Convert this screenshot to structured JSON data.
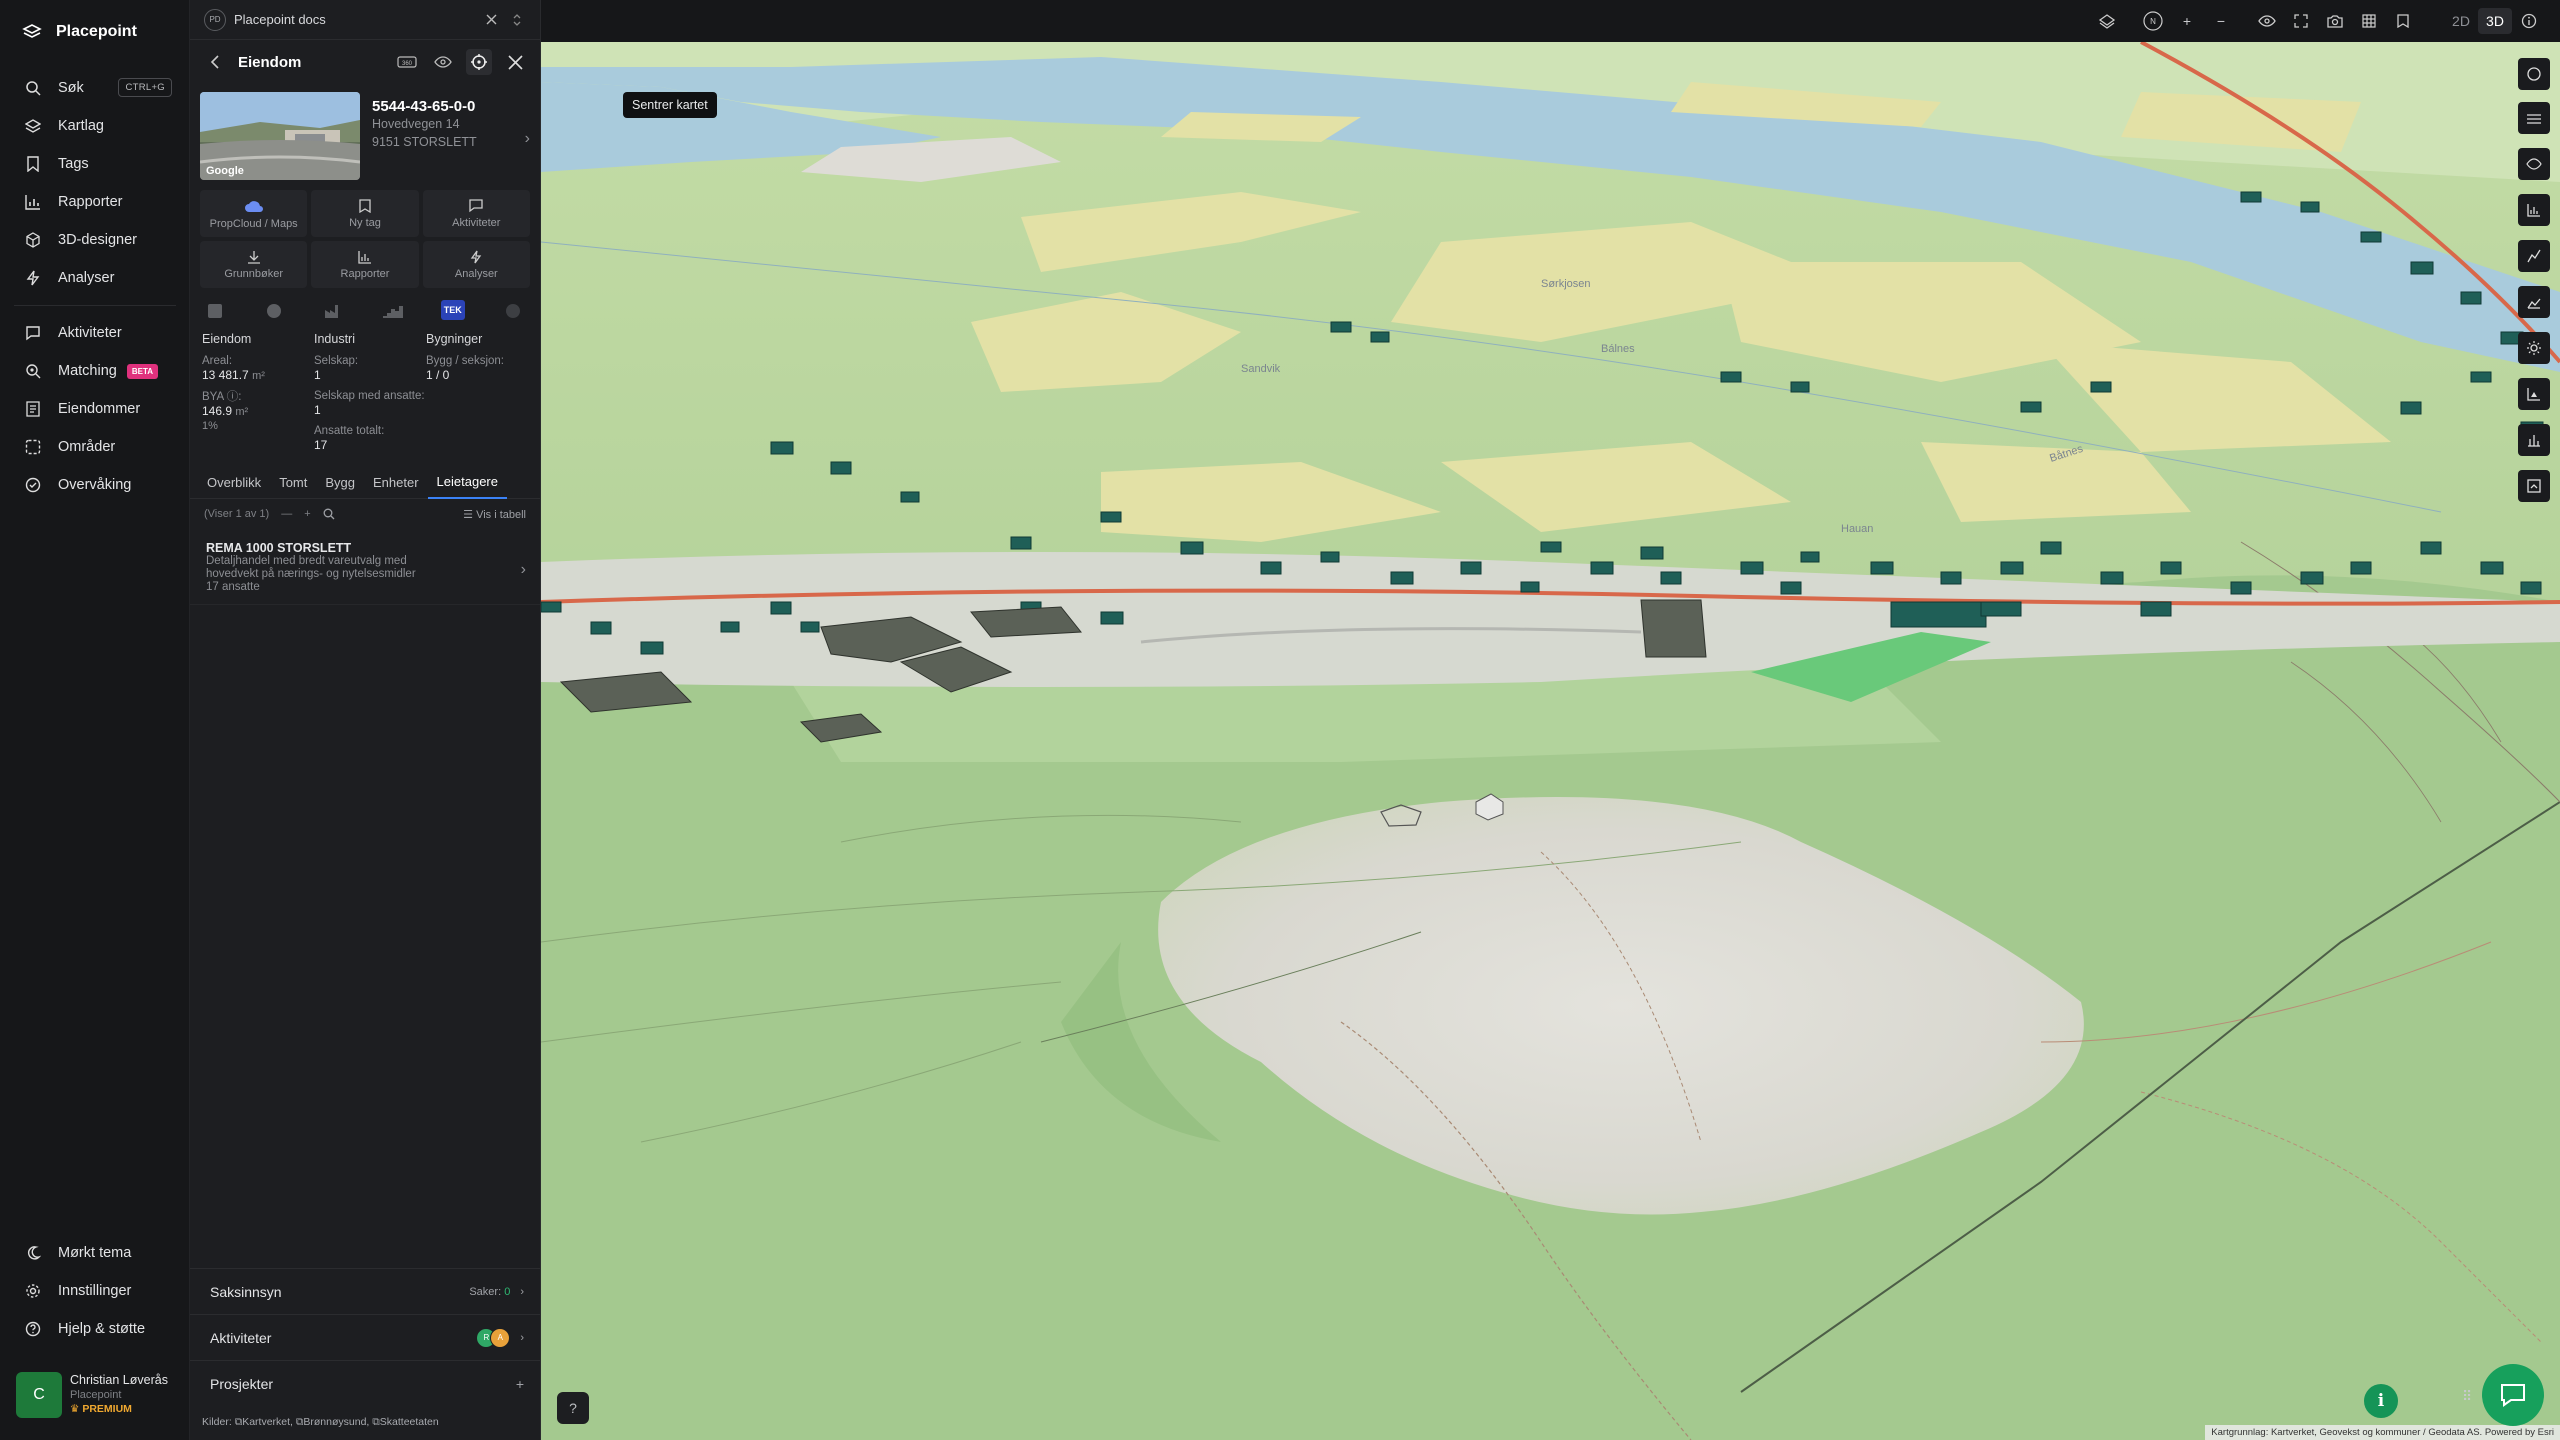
{
  "app": {
    "name": "Placepoint"
  },
  "nav": {
    "items": [
      {
        "label": "Søk",
        "shortcut": "CTRL+G",
        "icon": "search-icon"
      },
      {
        "label": "Kartlag",
        "icon": "layers-icon"
      },
      {
        "label": "Tags",
        "icon": "bookmark-icon"
      },
      {
        "label": "Rapporter",
        "icon": "chart-icon"
      },
      {
        "label": "3D-designer",
        "icon": "cube-icon"
      },
      {
        "label": "Analyser",
        "icon": "bolt-icon"
      }
    ],
    "items2": [
      {
        "label": "Aktiviteter",
        "icon": "chat-icon"
      },
      {
        "label": "Matching",
        "badge": "BETA",
        "icon": "target-icon"
      },
      {
        "label": "Eiendommer",
        "icon": "doc-icon"
      },
      {
        "label": "Områder",
        "icon": "dashed-square-icon"
      },
      {
        "label": "Overvåking",
        "icon": "check-circle-icon"
      }
    ],
    "bottom": [
      {
        "label": "Mørkt tema",
        "icon": "moon-icon"
      },
      {
        "label": "Innstillinger",
        "icon": "gear-icon"
      },
      {
        "label": "Hjelp & støtte",
        "icon": "help-icon"
      }
    ],
    "user": {
      "initial": "C",
      "name": "Christian Løverås",
      "org": "Placepoint",
      "plan": "PREMIUM"
    }
  },
  "panel": {
    "workspace": {
      "badge": "PD",
      "title": "Placepoint docs"
    },
    "header": {
      "title": "Eiendom",
      "tooltip": "Sentrer kartet",
      "badge_360": "360"
    },
    "property": {
      "id": "5544-43-65-0-0",
      "address": "Hovedvegen 14",
      "postal": "9151 STORSLETT",
      "thumb_label": "Google"
    },
    "actions": [
      {
        "label": "PropCloud / Maps",
        "icon": "cloud-icon"
      },
      {
        "label": "Ny tag",
        "icon": "bookmark-icon"
      },
      {
        "label": "Aktiviteter",
        "icon": "chat-icon"
      },
      {
        "label": "Grunnbøker",
        "icon": "download-icon"
      },
      {
        "label": "Rapporter",
        "icon": "chart-icon"
      },
      {
        "label": "Analyser",
        "icon": "bolt-icon"
      }
    ],
    "category_tek": "TEK",
    "facts": {
      "col1": {
        "heading": "Eiendom",
        "areal_label": "Areal:",
        "areal_value": "13 481.7",
        "areal_unit": "m²",
        "bya_label": "BYA ⓘ:",
        "bya_value": "146.9",
        "bya_unit": "m²",
        "bya_pct": "1%"
      },
      "col2": {
        "heading": "Industri",
        "selskap_label": "Selskap:",
        "selskap_value": "1",
        "ansatte_label": "Selskap med ansatte:",
        "ansatte_value": "1",
        "totalt_label": "Ansatte totalt:",
        "totalt_value": "17"
      },
      "col3": {
        "heading": "Bygninger",
        "bygg_label": "Bygg / seksjon:",
        "bygg_value": "1 / 0"
      }
    },
    "tabs": [
      "Overblikk",
      "Tomt",
      "Bygg",
      "Enheter",
      "Leietagere"
    ],
    "active_tab": "Leietagere",
    "list": {
      "showing": "(Viser 1 av 1)",
      "view_table": "Vis i tabell"
    },
    "tenant": {
      "name": "REMA 1000 STORSLETT",
      "desc": "Detaljhandel med bredt vareutvalg med hovedvekt på nærings- og nytelsesmidler",
      "employees": "17 ansatte"
    },
    "sections": [
      {
        "label": "Saksinnsyn",
        "meta_label": "Saker:",
        "meta_value": "0"
      },
      {
        "label": "Aktiviteter",
        "avatars": [
          "R",
          "A"
        ]
      },
      {
        "label": "Prosjekter",
        "action": "+"
      }
    ],
    "sources": {
      "label": "Kilder:",
      "items": [
        "Kartverket,",
        "Brønnøysund,",
        "Skatteetaten"
      ]
    }
  },
  "map": {
    "mode_2d": "2D",
    "mode_3d": "3D",
    "active_mode": "3D",
    "compass": "N",
    "attribution": "Kartgrunnlag: Kartverket, Geovekst og kommuner / Geodata AS. Powered by Esri",
    "help": "?",
    "info": "i",
    "place_labels": [
      "Sandvik",
      "Bálnes",
      "Båtnes",
      "Hauan",
      "Sørkjosen"
    ],
    "colors": {
      "water": "#a9cbdc",
      "field": "#e3e1a6",
      "grass": "#bcd99c",
      "forest": "#98c587",
      "road": "#d8684a",
      "building": "#1f5f57",
      "bare": "#dedcd6"
    }
  }
}
